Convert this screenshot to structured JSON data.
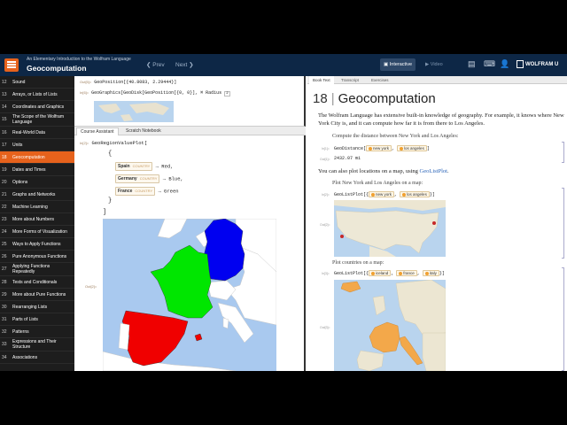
{
  "header": {
    "subtitle": "An Elementary Introduction to the Wolfram Language",
    "title": "Geocomputation",
    "prev": "Prev",
    "next": "Next",
    "interactive": "Interactive",
    "video": "Video",
    "brand": "WOLFRAM U"
  },
  "sidebar": {
    "items": [
      {
        "n": "12",
        "label": "Sound"
      },
      {
        "n": "13",
        "label": "Arrays, or Lists of Lists"
      },
      {
        "n": "14",
        "label": "Coordinates and Graphics"
      },
      {
        "n": "15",
        "label": "The Scope of the Wolfram Language"
      },
      {
        "n": "16",
        "label": "Real-World Data"
      },
      {
        "n": "17",
        "label": "Units"
      },
      {
        "n": "18",
        "label": "Geocomputation"
      },
      {
        "n": "19",
        "label": "Dates and Times"
      },
      {
        "n": "20",
        "label": "Options"
      },
      {
        "n": "21",
        "label": "Graphs and Networks"
      },
      {
        "n": "22",
        "label": "Machine Learning"
      },
      {
        "n": "23",
        "label": "More about Numbers"
      },
      {
        "n": "24",
        "label": "More Forms of Visualization"
      },
      {
        "n": "25",
        "label": "Ways to Apply Functions"
      },
      {
        "n": "26",
        "label": "Pure Anonymous Functions"
      },
      {
        "n": "27",
        "label": "Applying Functions Repeatedly"
      },
      {
        "n": "28",
        "label": "Tests and Conditionals"
      },
      {
        "n": "29",
        "label": "More about Pure Functions"
      },
      {
        "n": "30",
        "label": "Rearranging Lists"
      },
      {
        "n": "31",
        "label": "Parts of Lists"
      },
      {
        "n": "32",
        "label": "Patterns"
      },
      {
        "n": "33",
        "label": "Expressions and Their Structure"
      },
      {
        "n": "34",
        "label": "Associations"
      }
    ]
  },
  "top_cell": {
    "out_label": "Out[5]=",
    "out_text": "GeoPosition[{40.8083, 2.29444}]",
    "in_label": "In[6]=",
    "in_text": "GeoGraphics[GeoDisk[GeoPosition[{0, 0}], ⌘ Radius",
    "radius_value": "2"
  },
  "assistant": {
    "tabs": [
      "Course Assistant",
      "Scratch Notebook"
    ],
    "in_label": "In[2]=",
    "out_label": "Out[2]=",
    "func": "GeoRegionValuePlot[",
    "open_brace": "{",
    "close_brace": "}",
    "close_bracket": "]",
    "rows": [
      {
        "country": "Spain",
        "type": "COUNTRY",
        "value": "Red,"
      },
      {
        "country": "Germany",
        "type": "COUNTRY",
        "value": "Blue,"
      },
      {
        "country": "France",
        "type": "COUNTRY",
        "value": "Green"
      }
    ],
    "colors": {
      "spain": "#f00000",
      "germany": "#0000f0",
      "france": "#00e600",
      "sea": "#a9c9ef",
      "land": "#ffffff"
    }
  },
  "book": {
    "tabs": [
      "Book Text",
      "Transcript",
      "Exercises"
    ],
    "chapter_num": "18",
    "chapter_title": "Geocomputation",
    "intro": "The Wolfram Language has extensive built-in knowledge of geography. For example, it knows where New York City is, and it can compute how far it is from there to Los Angeles.",
    "step1": "Compute the distance between New York and Los Angeles:",
    "in1": "In[1]=",
    "geodistance": "GeoDistance[",
    "ny": "new york",
    "la": "los angeles",
    "out1": "Out[1]=",
    "distance": "2432.07 mi",
    "plot_text_prefix": "You can also plot locations on a map, using ",
    "plot_text_link": "GeoListPlot",
    "plot_text_suffix": ".",
    "step2": "Plot New York and Los Angeles on a map:",
    "in2": "In[2]=",
    "geolistplot": "GeoListPlot[{",
    "out2": "Out[2]=",
    "step3": "Plot countries on a map:",
    "in3": "In[3]=",
    "iceland": "iceland",
    "france": "france",
    "italy": "italy",
    "out3": "Out[3]="
  }
}
